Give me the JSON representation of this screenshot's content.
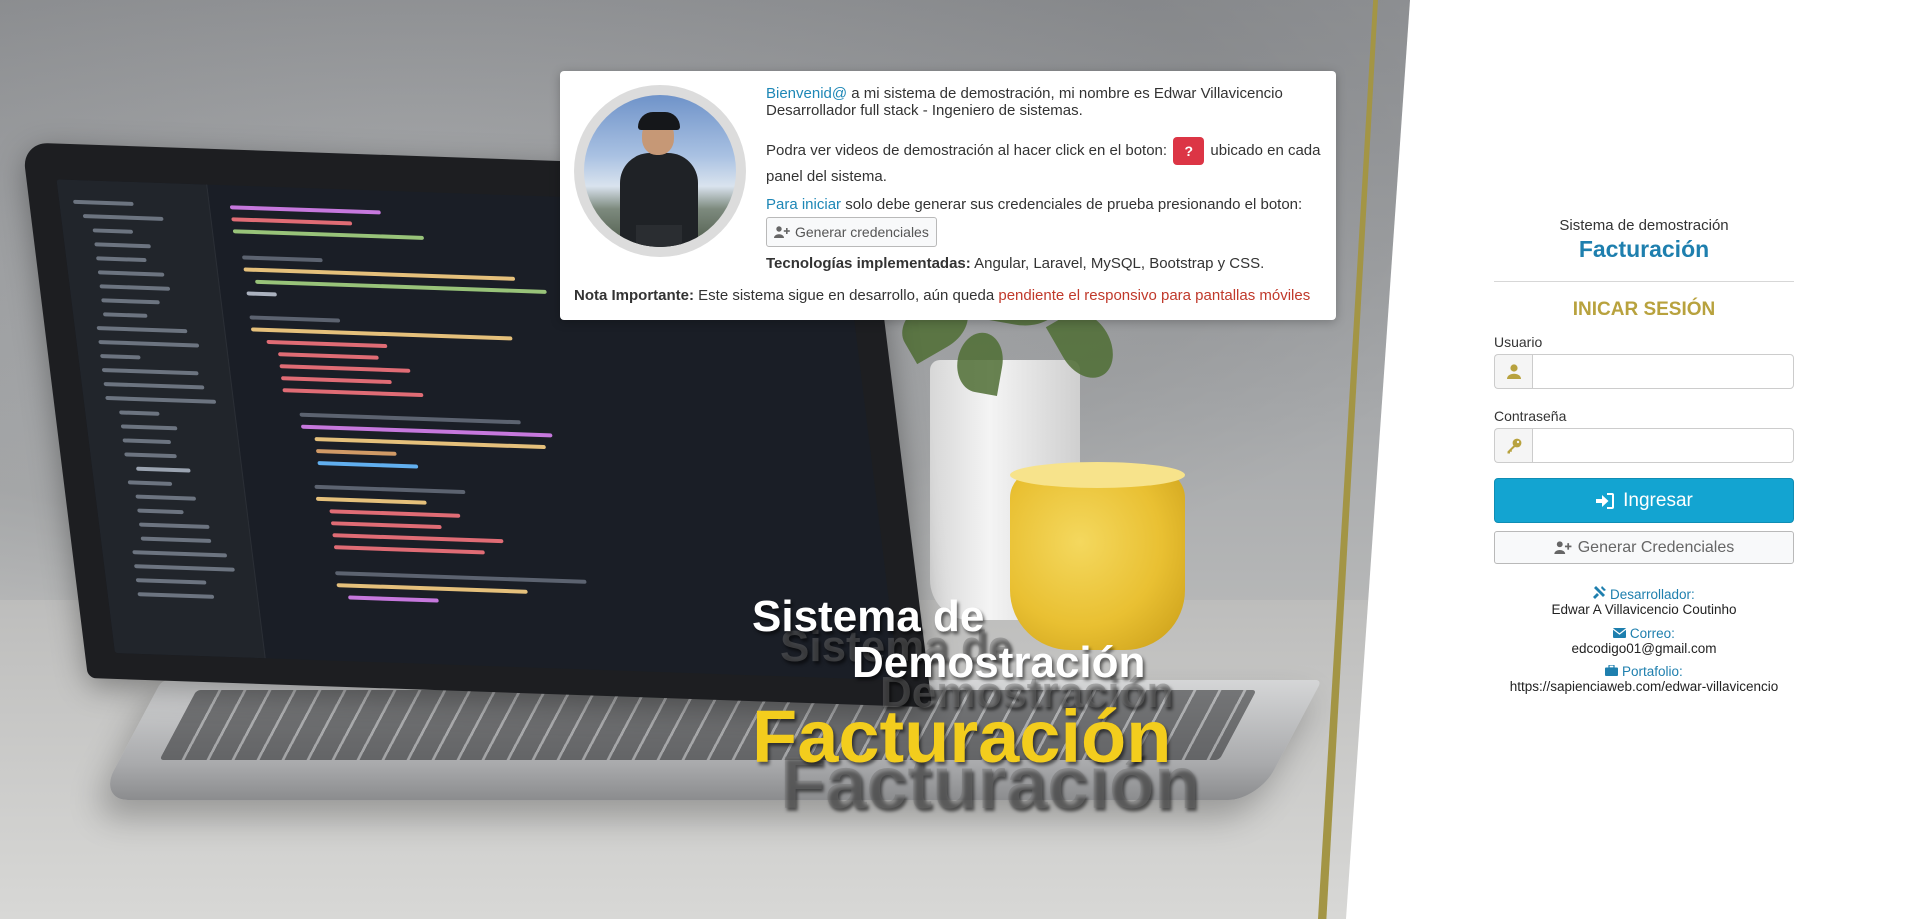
{
  "info_card": {
    "welcome_link": "Bienvenid@",
    "welcome_rest": " a mi sistema de demostración, mi nombre es Edwar Villavicencio",
    "role": "Desarrollador full stack - Ingeniero de sistemas.",
    "videos_text_before": "Podra ver videos de demostración al hacer click en el boton:",
    "help_button_label": "?",
    "videos_text_after": " ubicado en cada panel del sistema.",
    "start_link": "Para iniciar",
    "start_rest": " solo debe generar sus credenciales de prueba presionando el boton:",
    "generate_button_label": "Generar credenciales",
    "tech_label": "Tecnologías implementadas:",
    "tech_value": " Angular, Laravel, MySQL, Bootstrap y CSS.",
    "note_label": "Nota Importante:",
    "note_text": " Este sistema sigue en desarrollo, aún queda ",
    "note_highlight": "pendiente el responsivo para pantallas móviles"
  },
  "hero": {
    "line1": "Sistema de",
    "line2": "Demostración",
    "line3": "Facturación"
  },
  "login": {
    "subtitle": "Sistema de demostración",
    "title": "Facturación",
    "heading": "INICAR SESIÓN",
    "user_label": "Usuario",
    "user_value": "",
    "password_label": "Contraseña",
    "password_value": "",
    "login_button": "Ingresar",
    "generate_button": "Generar Credenciales",
    "developer_label": "Desarrollador:",
    "developer_value": "Edwar A Villavicencio Coutinho",
    "email_label": "Correo:",
    "email_value": "edcodigo01@gmail.com",
    "portfolio_label": "Portafolio:",
    "portfolio_value": "https://sapienciaweb.com/edwar-villavicencio"
  },
  "colors": {
    "accent_blue": "#13a4d1",
    "title_blue": "#1e7fae",
    "gold": "#b8a23e",
    "hero_yellow": "#f3cd1d",
    "danger": "#dc3545"
  },
  "icons": [
    "help-icon",
    "user-plus-icon",
    "user-icon",
    "key-icon",
    "sign-in-icon",
    "tools-icon",
    "envelope-icon",
    "briefcase-icon"
  ]
}
